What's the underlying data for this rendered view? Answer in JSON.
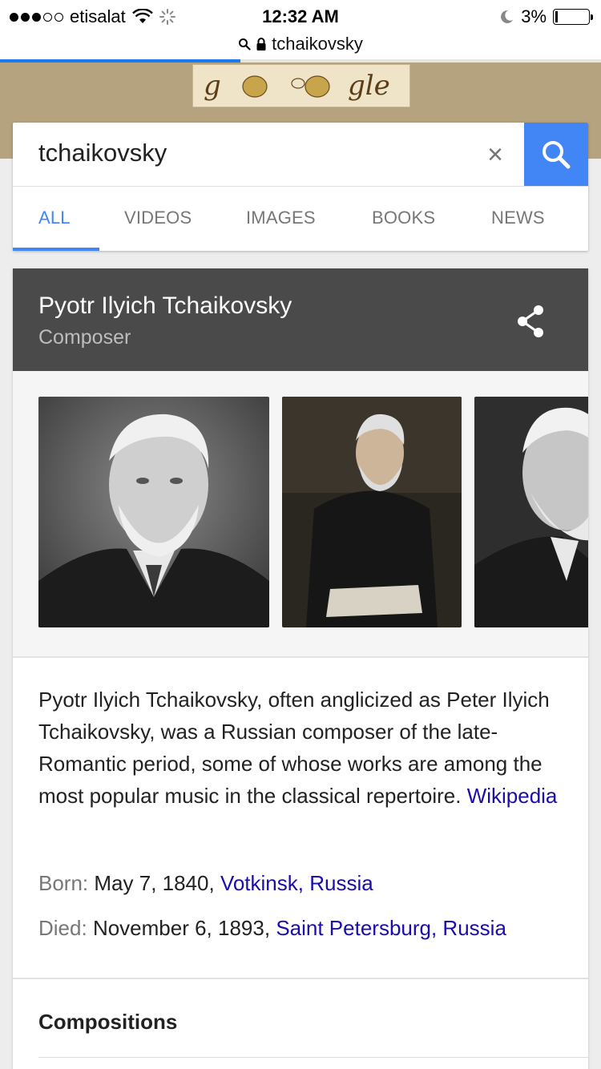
{
  "status_bar": {
    "carrier": "etisalat",
    "time": "12:32 AM",
    "battery": "3%",
    "battery_level": 0.03
  },
  "url_bar": {
    "domain": "tchaikovsky"
  },
  "search": {
    "query": "tchaikovsky",
    "clear_label": "×",
    "tabs": [
      {
        "label": "ALL",
        "active": true
      },
      {
        "label": "VIDEOS",
        "active": false
      },
      {
        "label": "IMAGES",
        "active": false
      },
      {
        "label": "BOOKS",
        "active": false
      },
      {
        "label": "NEWS",
        "active": false
      }
    ],
    "accent_color": "#4285f4"
  },
  "knowledge_panel": {
    "title": "Pyotr Ilyich Tchaikovsky",
    "subtitle": "Composer",
    "header_color": "#4a4a4a",
    "description": "Pyotr Ilyich Tchaikovsky, often anglicized as Peter Ilyich Tchaikovsky, was a Russian composer of the late-Romantic period, some of whose works are among the most popular music in the classical repertoire.",
    "source_link": "Wikipedia",
    "facts": [
      {
        "label": "Born:",
        "value": "May 7, 1840,",
        "link": "Votkinsk, Russia"
      },
      {
        "label": "Died:",
        "value": "November 6, 1893,",
        "link": "Saint Petersburg, Russia"
      }
    ],
    "section_title": "Compositions",
    "link_color": "#1a0dab"
  }
}
